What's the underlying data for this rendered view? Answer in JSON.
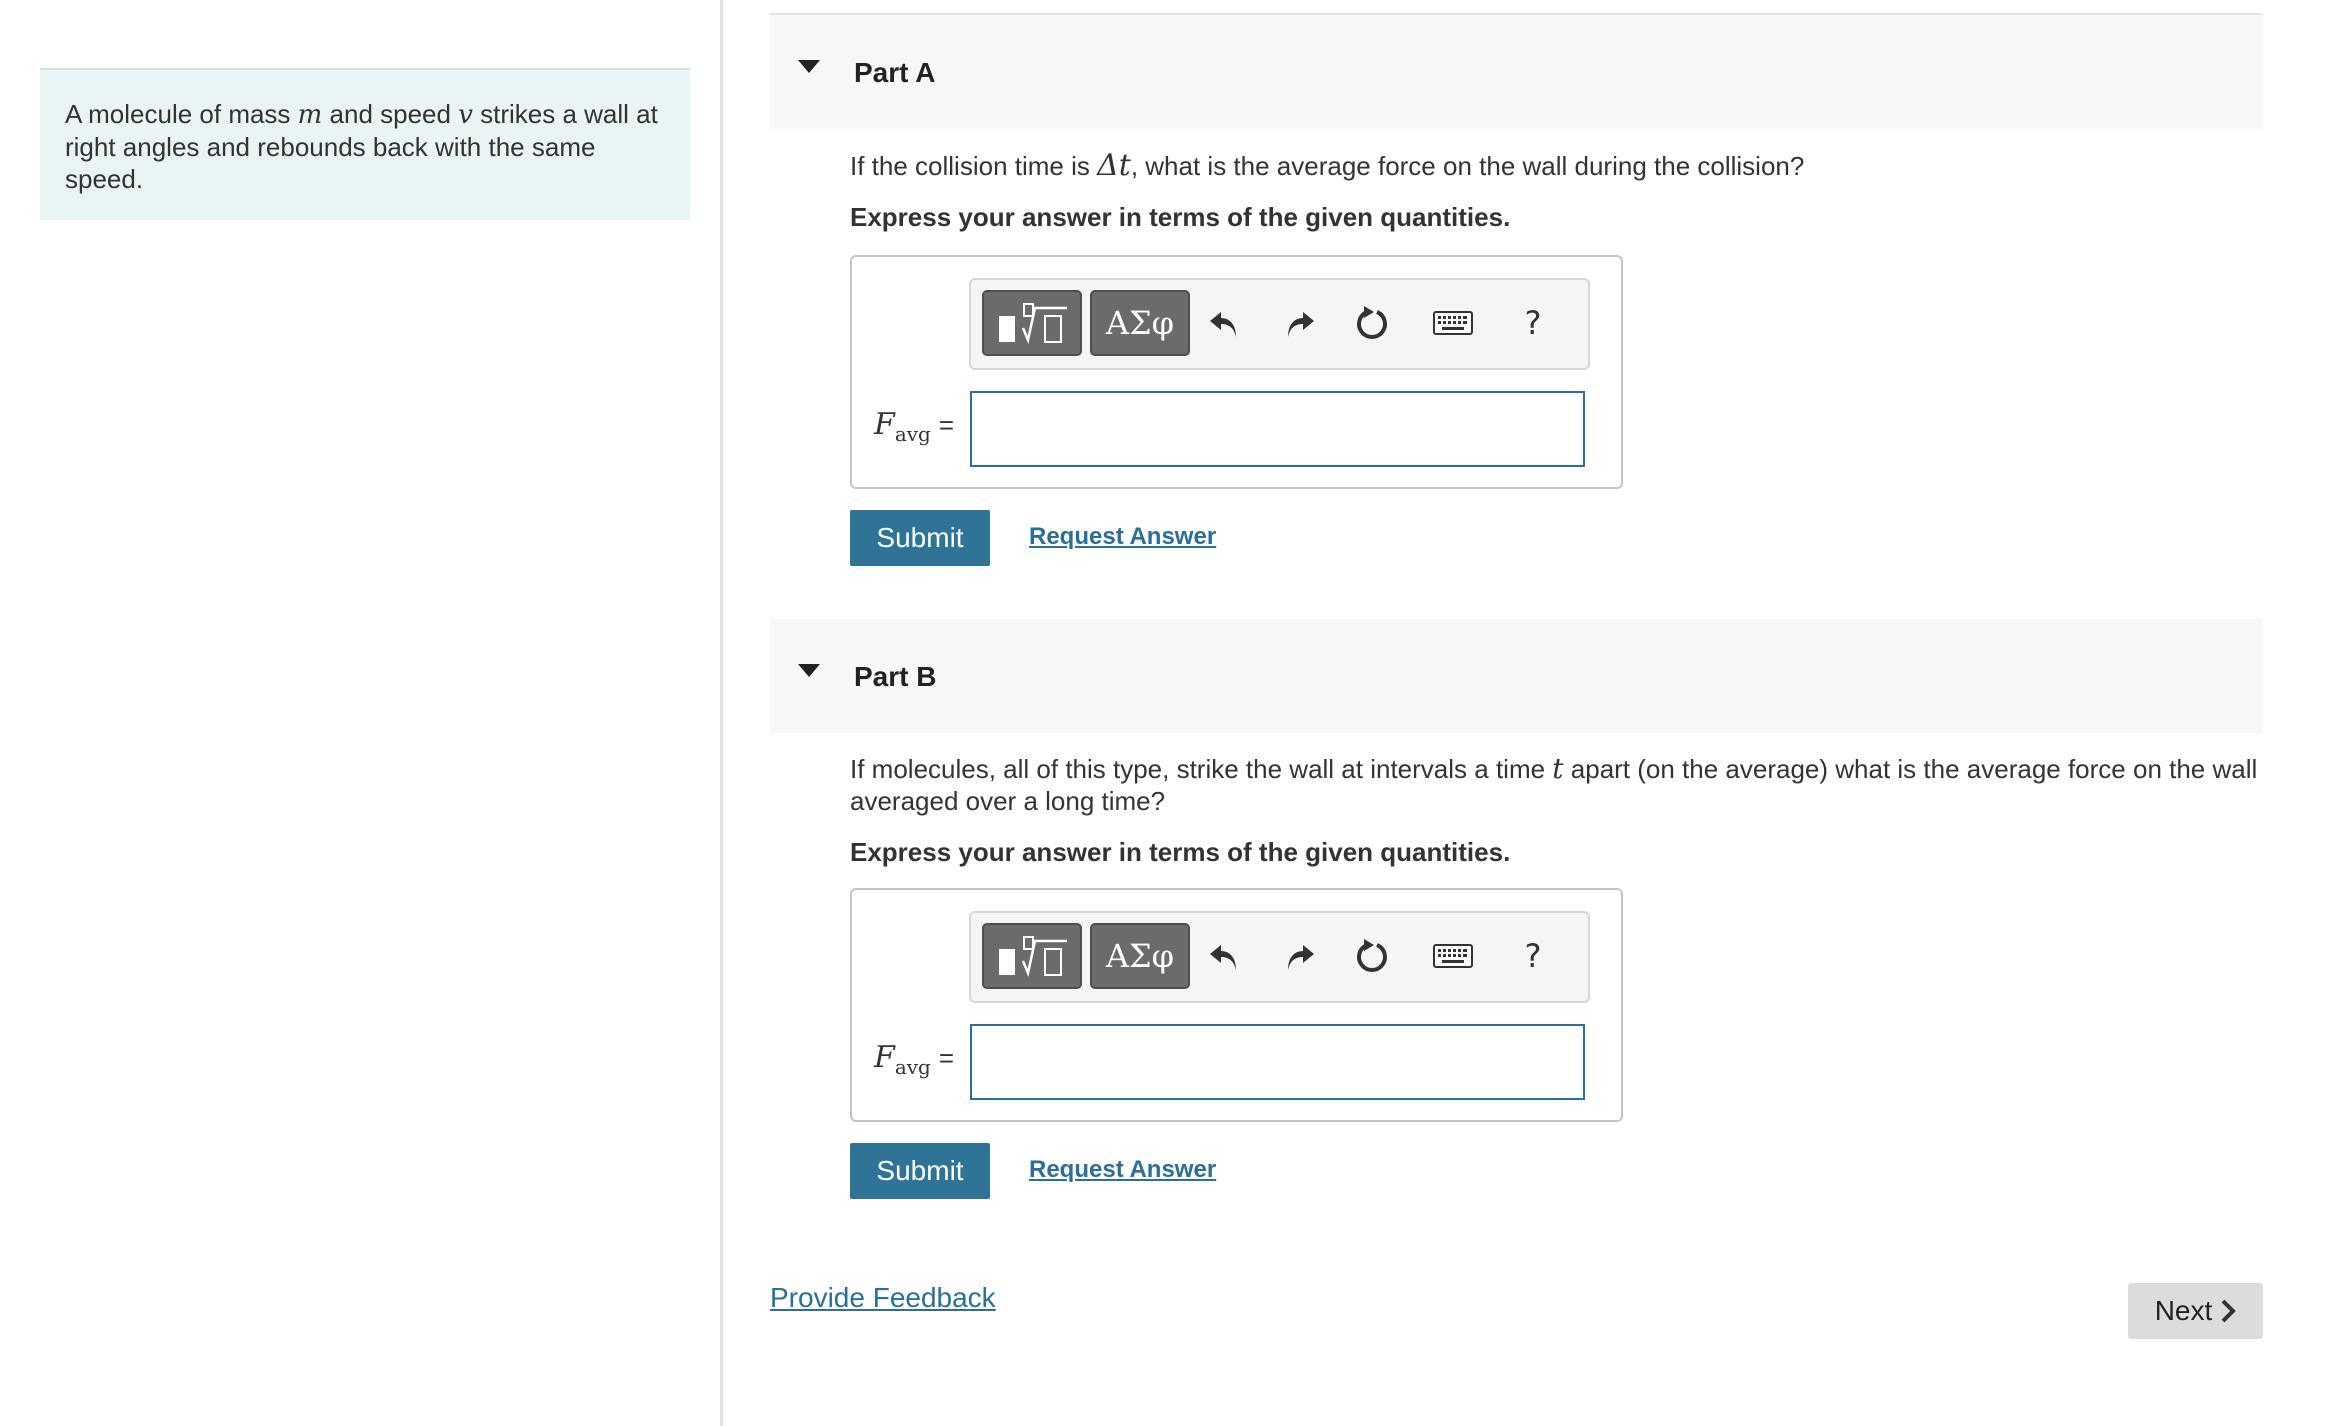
{
  "intro": {
    "text_1": "A molecule of mass ",
    "var_m": "m",
    "text_2": " and speed ",
    "var_v": "v",
    "text_3": " strikes a wall at right angles and rebounds back with the same speed."
  },
  "parts": [
    {
      "title": "Part A",
      "question_1": "If the collision time is ",
      "question_var": "Δt",
      "question_2": ", what is the average force on the wall during the collision?",
      "instruction": "Express your answer in terms of the given quantities.",
      "label_symbol": "F",
      "label_sub": "avg",
      "label_eq": "=",
      "answer_value": "",
      "submit_label": "Submit",
      "request_label": "Request Answer"
    },
    {
      "title": "Part B",
      "question_1": "If molecules, all of this type, strike the wall at intervals a time ",
      "question_var": "t",
      "question_2": " apart (on the average) what is the average force on the wall averaged over a long time?",
      "instruction": "Express your answer in terms of the given quantities.",
      "label_symbol": "F",
      "label_sub": "avg",
      "label_eq": "=",
      "answer_value": "",
      "submit_label": "Submit",
      "request_label": "Request Answer"
    }
  ],
  "toolbar": {
    "greek_label": "ΑΣφ",
    "help_label": "?",
    "icons": [
      "templates-icon",
      "greek-letters-icon",
      "undo-icon",
      "redo-icon",
      "reset-icon",
      "keyboard-icon",
      "help-icon"
    ]
  },
  "footer": {
    "feedback_label": "Provide Feedback",
    "next_label": "Next"
  },
  "colors": {
    "accent": "#2f7396",
    "link": "#2a6f97",
    "intro_bg": "#e9f4f5",
    "part_header_bg": "#f7f7f7",
    "next_bg": "#dcdcdc"
  }
}
